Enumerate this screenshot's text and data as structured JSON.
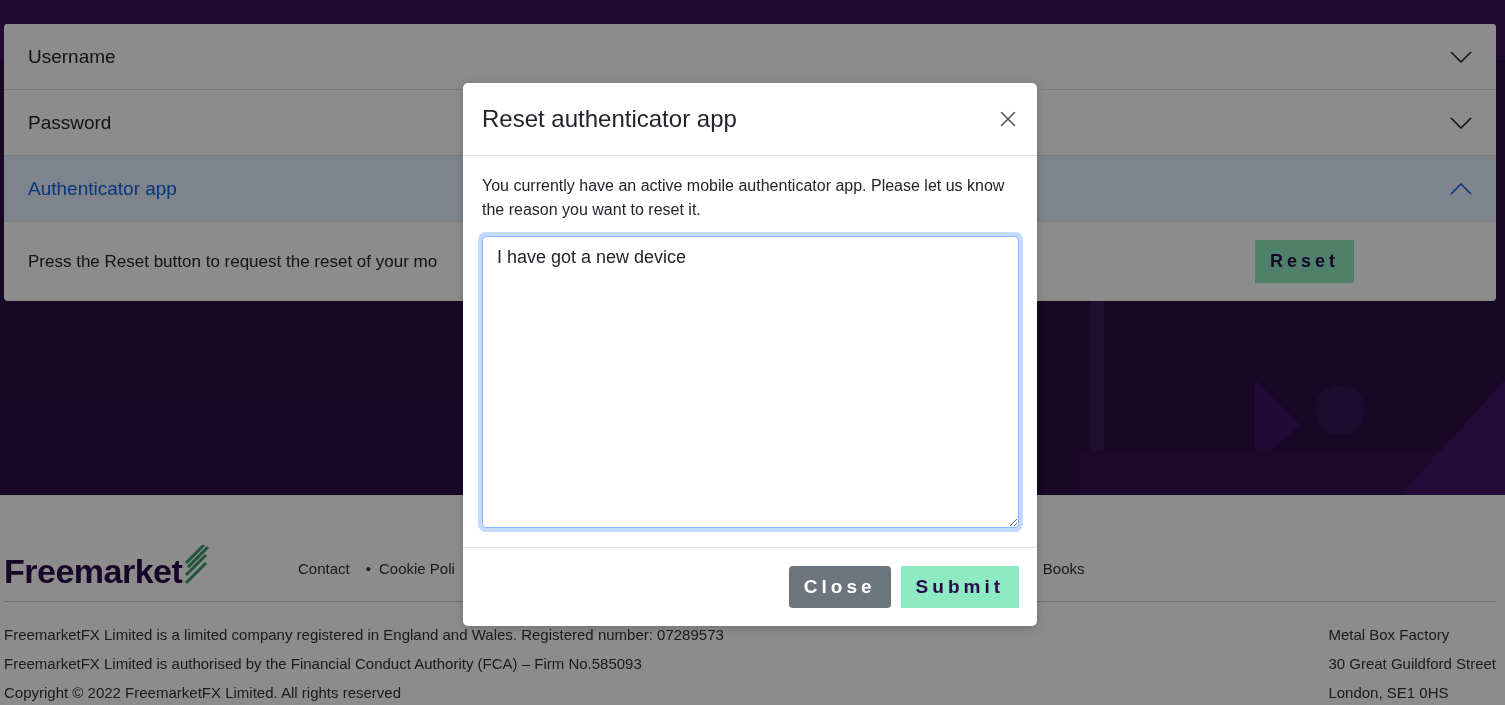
{
  "accordion": [
    {
      "title": "Username",
      "expanded": false
    },
    {
      "title": "Password",
      "expanded": false
    },
    {
      "title": "Authenticator app",
      "expanded": true,
      "body": "Press the Reset button to request the reset of your mo",
      "button": "Reset"
    }
  ],
  "footer": {
    "logo": "Freemarket",
    "links": [
      {
        "label": "Contact"
      },
      {
        "bullet": "•",
        "label": "Cookie Poli"
      },
      {
        "label": "Books"
      }
    ],
    "legal": [
      "FreemarketFX Limited is a limited company registered in England and Wales. Registered number: 07289573",
      "FreemarketFX Limited is authorised by the Financial Conduct Authority (FCA) – Firm No.585093",
      "Copyright © 2022 FreemarketFX Limited. All rights reserved"
    ],
    "address": [
      "Metal Box Factory",
      "30 Great Guildford Street",
      "London, SE1 0HS"
    ]
  },
  "modal": {
    "title": "Reset authenticator app",
    "text": "You currently have an active mobile authenticator app. Please let us know the reason you want to reset it.",
    "value": "I have got a new device",
    "buttons": [
      {
        "kind": "secondary",
        "label": "Close"
      },
      {
        "kind": "primary",
        "label": "Submit"
      }
    ]
  }
}
